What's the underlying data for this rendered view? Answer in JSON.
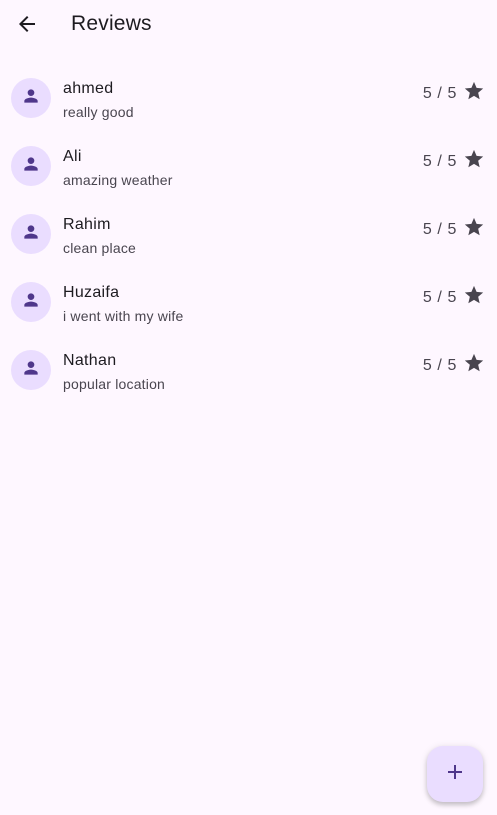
{
  "appbar": {
    "title": "Reviews"
  },
  "reviews": [
    {
      "name": "ahmed",
      "comment": "really good",
      "rating": "5 / 5"
    },
    {
      "name": "Ali",
      "comment": "amazing weather",
      "rating": "5 / 5"
    },
    {
      "name": "Rahim",
      "comment": "clean place",
      "rating": "5 / 5"
    },
    {
      "name": "Huzaifa",
      "comment": "i went with my wife",
      "rating": "5 / 5"
    },
    {
      "name": "Nathan",
      "comment": "popular location",
      "rating": "5 / 5"
    }
  ],
  "icons": {
    "back": "arrow-back-icon",
    "avatar": "person-icon",
    "rating": "star-icon",
    "fab": "add-icon"
  },
  "colors": {
    "background": "#fef7ff",
    "avatar_bg": "#eaddff",
    "avatar_icon": "#4f378b",
    "star": "#49454f",
    "fab_bg": "#eaddff",
    "fab_icon": "#4f378b"
  }
}
